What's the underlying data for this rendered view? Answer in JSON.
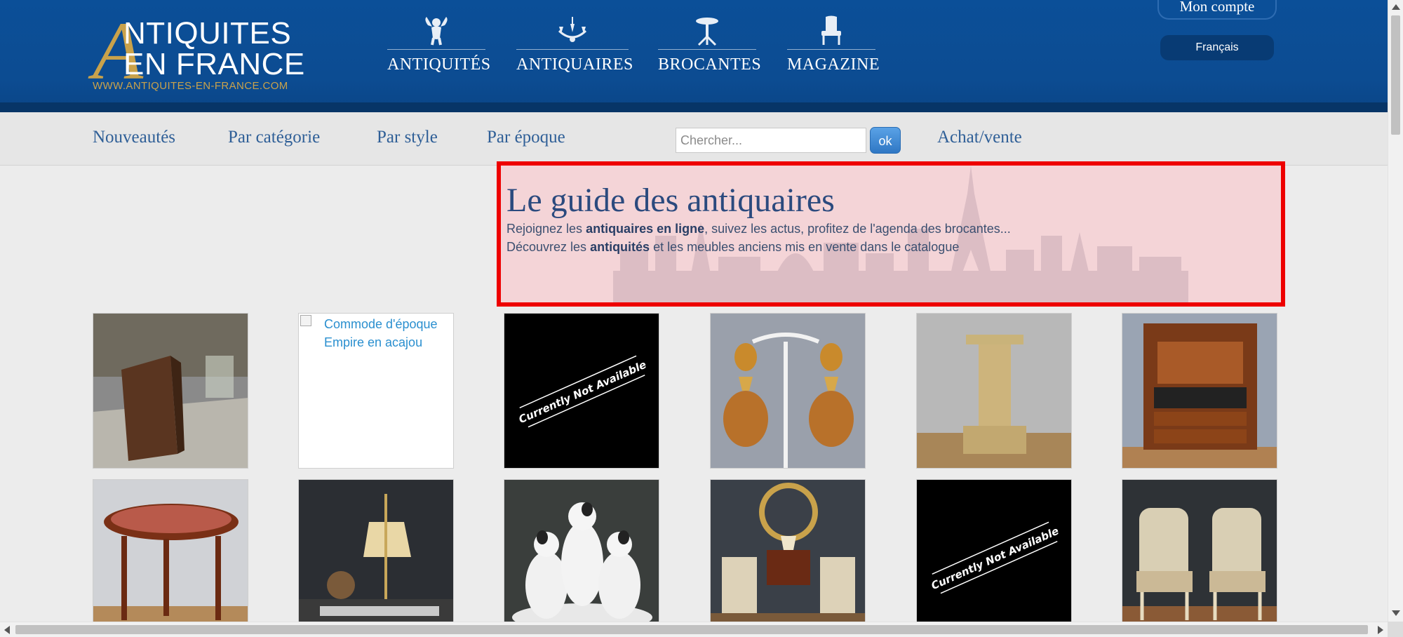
{
  "logo": {
    "letter": "A",
    "line1": "NTIQUITES",
    "line2": "EN FRANCE",
    "url": "WWW.ANTIQUITES-EN-FRANCE.COM",
    "gold": "#c9a24b"
  },
  "main_nav": [
    {
      "label": "ANTIQUITÉS",
      "icon": "cherub-icon"
    },
    {
      "label": "ANTIQUAIRES",
      "icon": "chandelier-icon"
    },
    {
      "label": "BROCANTES",
      "icon": "pedestal-table-icon"
    },
    {
      "label": "MAGAZINE",
      "icon": "armchair-icon"
    }
  ],
  "account": {
    "label": "Mon compte"
  },
  "language": {
    "label": "Français"
  },
  "sub_nav": {
    "items": [
      "Nouveautés",
      "Par catégorie",
      "Par style",
      "Par époque"
    ],
    "search_placeholder": "Chercher...",
    "search_button": "ok",
    "extra": "Achat/vente"
  },
  "hero": {
    "title": "Le guide des antiquaires",
    "line1_pre": "Rejoignez les ",
    "line1_bold": "antiquaires en ligne",
    "line1_post": ", suivez les actus, profitez de l'agenda des brocantes...",
    "line2_pre": "Découvrez les ",
    "line2_bold": "antiquités",
    "line2_post": " et les meubles anciens mis en vente dans le catalogue",
    "highlight_border": "#ee0000",
    "highlight_fill": "#f4d4d7"
  },
  "grid": {
    "broken_alt": "Commode d'époque Empire en acajou",
    "unavailable_text": "Currently Not Available",
    "tiles": [
      {
        "kind": "photo",
        "subject": "secretary-desk"
      },
      {
        "kind": "broken"
      },
      {
        "kind": "unavailable"
      },
      {
        "kind": "photo",
        "subject": "earrings"
      },
      {
        "kind": "photo",
        "subject": "column-pedestal"
      },
      {
        "kind": "photo",
        "subject": "empire-secretary"
      },
      {
        "kind": "photo",
        "subject": "oval-table"
      },
      {
        "kind": "photo",
        "subject": "lamp"
      },
      {
        "kind": "photo",
        "subject": "dog-figurines"
      },
      {
        "kind": "photo",
        "subject": "mirror-chairs"
      },
      {
        "kind": "unavailable"
      },
      {
        "kind": "photo",
        "subject": "pair-armchairs"
      }
    ]
  },
  "colors": {
    "header_blue": "#0b4f98",
    "header_dark": "#073567",
    "link_blue": "#2f5f97",
    "subnav_bg": "#e6e6e6"
  }
}
